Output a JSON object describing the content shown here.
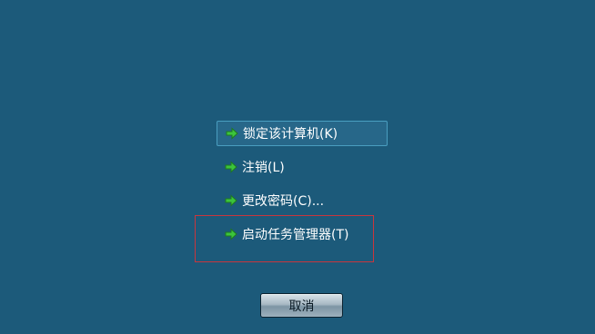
{
  "menu": {
    "items": [
      {
        "label": "锁定该计算机(K)",
        "icon": "green-arrow-icon",
        "selected": true
      },
      {
        "label": "注销(L)",
        "icon": "green-arrow-icon",
        "selected": false
      },
      {
        "label": "更改密码(C)...",
        "icon": "green-arrow-icon",
        "selected": false
      },
      {
        "label": "启动任务管理器(T)",
        "icon": "green-arrow-icon",
        "selected": false
      }
    ]
  },
  "cancel_button": {
    "label": "取消"
  },
  "colors": {
    "background": "#1c5a7a",
    "highlight_border": "#c8363d",
    "arrow": "#3cc43c"
  }
}
